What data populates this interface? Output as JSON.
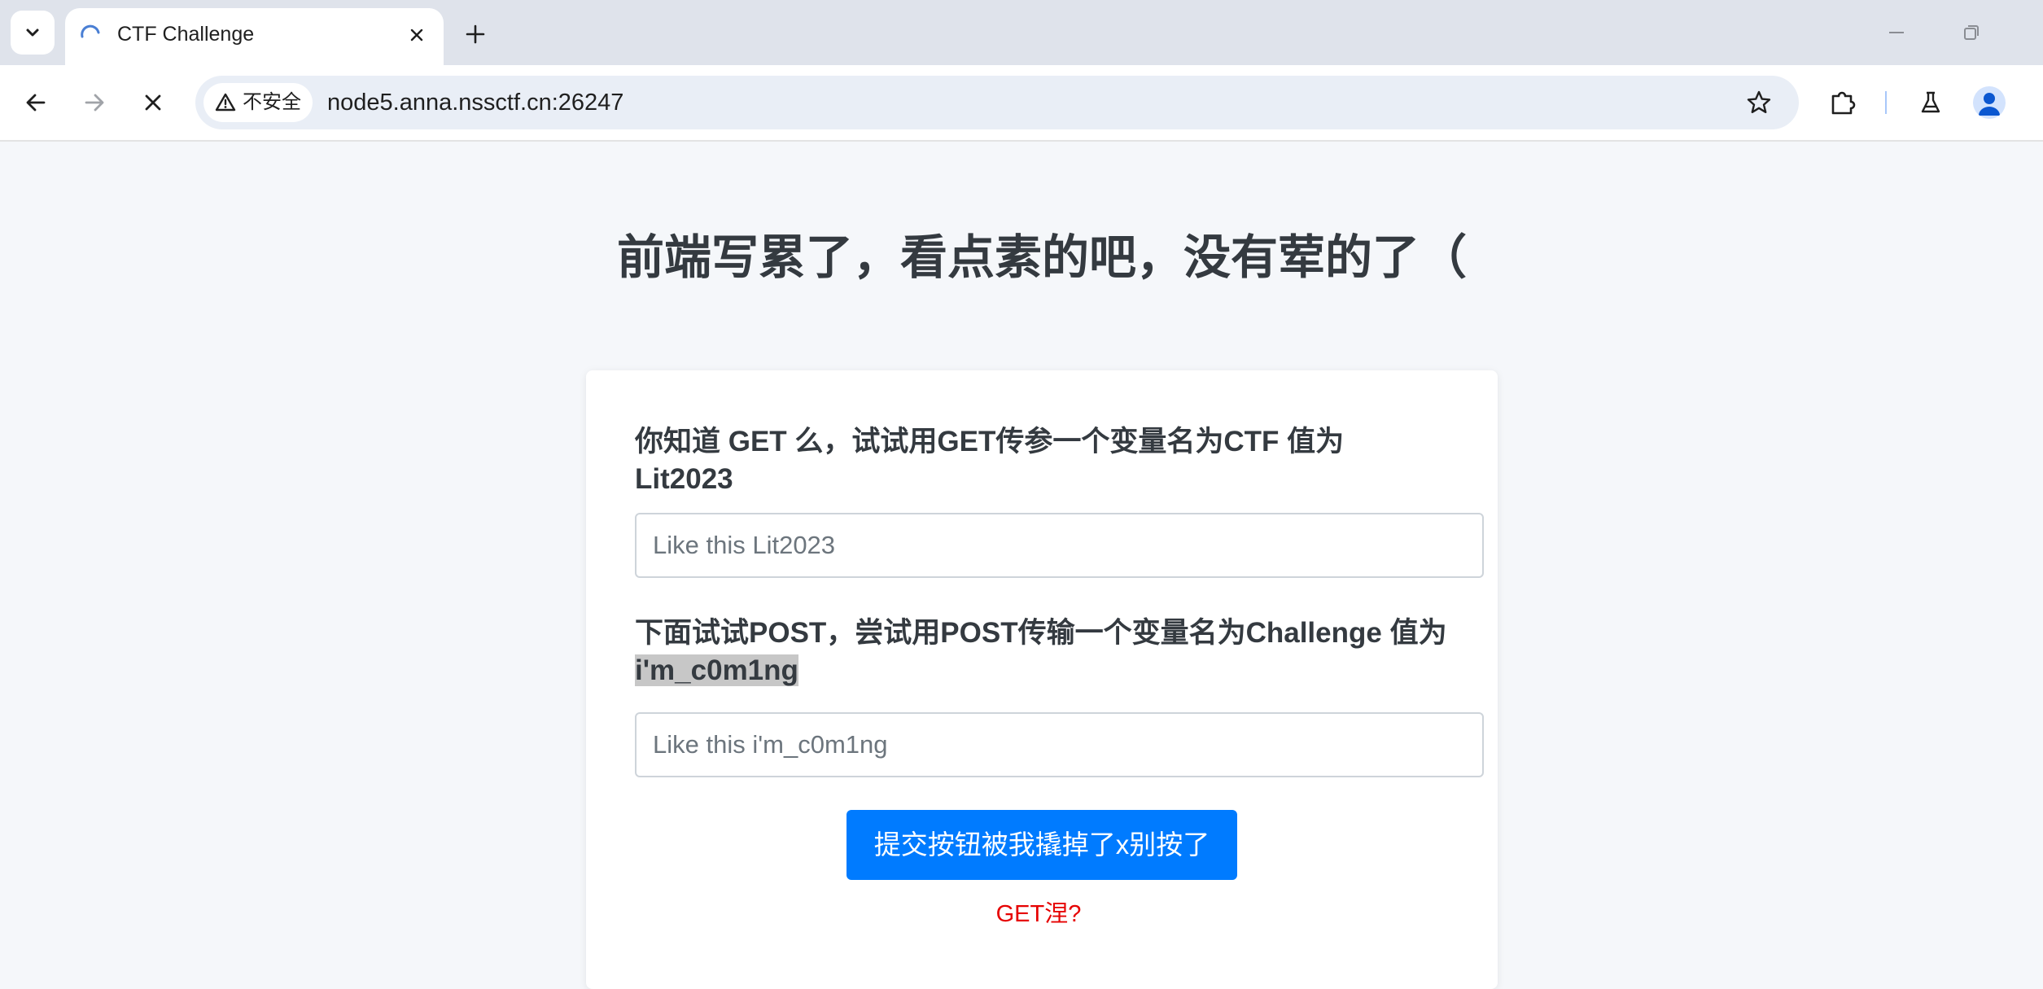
{
  "browser": {
    "tab": {
      "title": "CTF Challenge"
    },
    "address_bar": {
      "security_label": "不安全",
      "url": "node5.anna.nssctf.cn:26247"
    }
  },
  "page": {
    "heading": "前端写累了，看点素的吧，没有荤的了（",
    "get_prompt": "你知道 GET 么，试试用GET传参一个变量名为CTF 值为 Lit2023",
    "get_placeholder": "Like this Lit2023",
    "post_prompt_prefix": "下面试试POST，尝试用POST传输一个变量名为Challenge 值为 ",
    "post_prompt_value": "i'm_c0m1ng",
    "post_placeholder": "Like this i'm_c0m1ng",
    "submit_label": "提交按钮被我撬掉了x别按了",
    "status_message": "GET涅?"
  },
  "colors": {
    "accent": "#007bff",
    "status": "#e60000",
    "highlight": "#c7c7c7"
  },
  "icons": [
    "tab-list-icon",
    "loading-spinner-icon",
    "close-icon",
    "plus-icon",
    "minimize-icon",
    "restore-icon",
    "back-arrow-icon",
    "forward-arrow-icon",
    "stop-icon",
    "warning-icon",
    "star-icon",
    "extensions-icon",
    "labs-flask-icon",
    "profile-avatar-icon"
  ]
}
